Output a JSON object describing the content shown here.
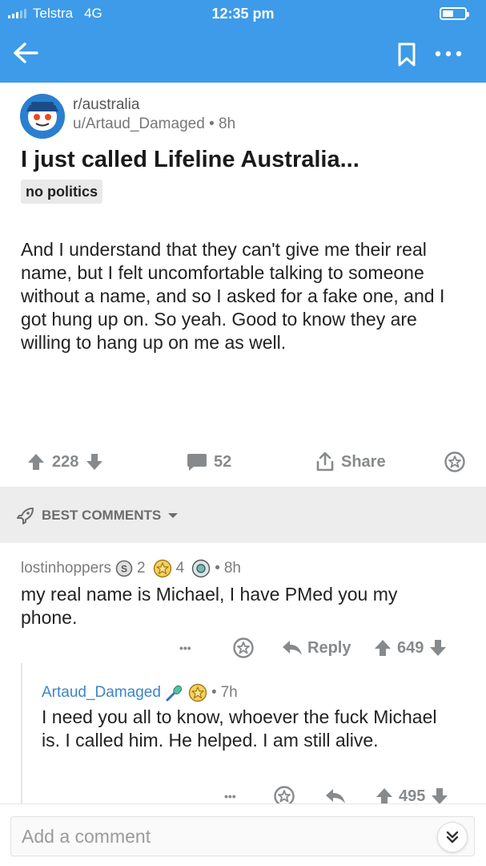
{
  "status_bar": {
    "carrier": "Telstra",
    "network": "4G",
    "time": "12:35 pm"
  },
  "toolbar": {
    "back_icon": "arrow-left-icon",
    "bookmark_icon": "bookmark-icon",
    "more_icon": "more-dots-icon"
  },
  "post": {
    "subreddit": "r/australia",
    "author": "u/Artaud_Damaged",
    "age": "8h",
    "title": "I just called Lifeline Australia...",
    "flair": "no politics",
    "body": "And I understand that they can't give me their real name, but I felt uncomfortable talking to someone without a name, and so I asked for a fake one, and I got hung up on. So yeah. Good to know they are willing to hang up on me as well.",
    "score": "228",
    "comments": "52",
    "share_label": "Share"
  },
  "sort": {
    "label": "BEST COMMENTS"
  },
  "comments": [
    {
      "author": "lostinhoppers",
      "award1_count": "2",
      "award2_count": "4",
      "age": "8h",
      "body": "my real name is Michael, I have PMed you my phone.",
      "more": "•••",
      "reply_label": "Reply",
      "score": "649"
    },
    {
      "author": "Artaud_Damaged",
      "age": "7h",
      "body": "I need you all to know, whoever the fuck Michael is. I called him. He helped. I am still alive.",
      "more": "•••",
      "score": "495"
    }
  ],
  "composer": {
    "placeholder": "Add a comment"
  },
  "colors": {
    "header_blue": "#3d9be9",
    "op_blue": "#3d85c6",
    "meta_gray": "#878a8c"
  }
}
